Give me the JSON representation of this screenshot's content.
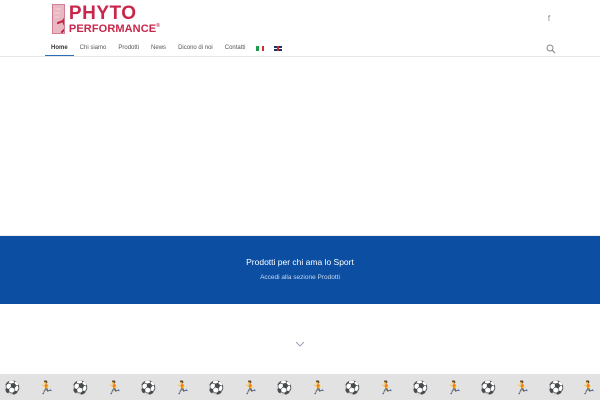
{
  "brand": {
    "line1": "PHYTO",
    "line2": "PERFORMANCE",
    "trademark": "®",
    "color": "#c8264b"
  },
  "social": {
    "icon": "facebook-icon",
    "glyph": "f"
  },
  "nav": {
    "items": [
      {
        "label": "Home",
        "active": true
      },
      {
        "label": "Chi siamo",
        "active": false
      },
      {
        "label": "Prodotti",
        "active": false
      },
      {
        "label": "News",
        "active": false
      },
      {
        "label": "Dicono di noi",
        "active": false
      },
      {
        "label": "Contatti",
        "active": false
      }
    ],
    "languages": [
      "it-flag-icon",
      "en-flag-icon"
    ],
    "search_icon": "search-icon"
  },
  "banner": {
    "title": "Prodotti per chi ama lo Sport",
    "link": "Accedi alla sezione Prodotti",
    "background": "#0b4ea2"
  },
  "scroll_icon": "chevron-down-icon",
  "colors": {
    "accent": "#2c6db5",
    "pattern_bg": "#e2e2e2"
  }
}
